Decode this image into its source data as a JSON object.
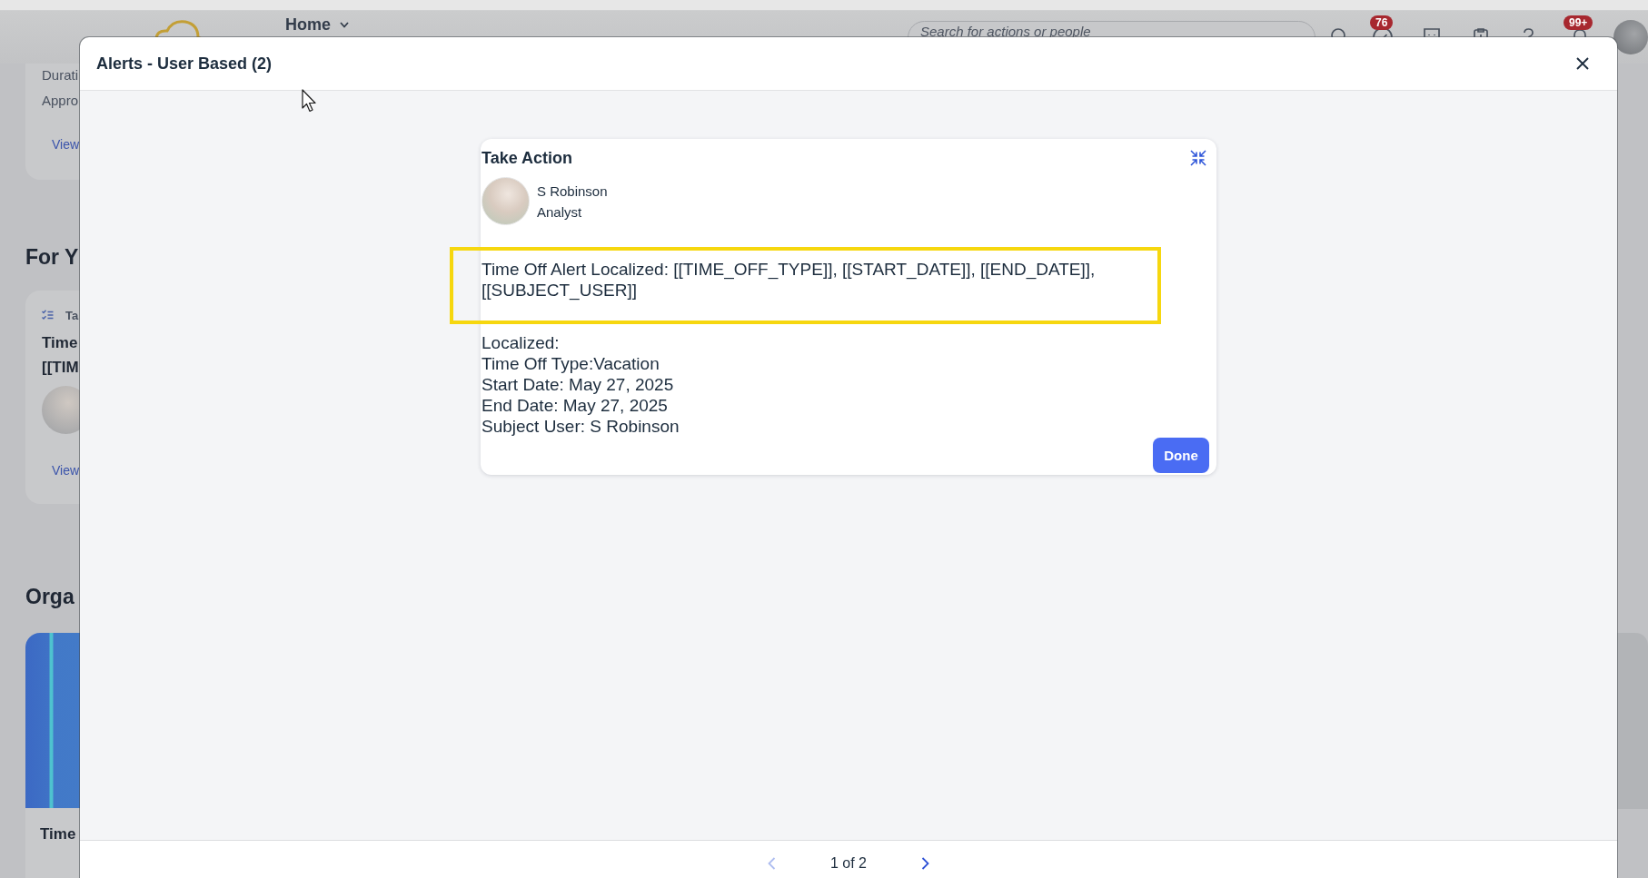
{
  "top_bar": {
    "menu": {
      "label": "Home"
    },
    "search": {
      "placeholder": "Search for actions or people"
    },
    "actions": [
      {
        "kind": "search"
      },
      {
        "kind": "check",
        "badge": "76"
      },
      {
        "kind": "chat"
      },
      {
        "kind": "clipboard"
      },
      {
        "kind": "help"
      },
      {
        "kind": "bell",
        "badge": "99+"
      }
    ]
  },
  "background": {
    "first_card": {
      "lines": [
        "Durati",
        "Appro"
      ],
      "link": "View"
    },
    "sections": [
      {
        "heading": "For Y",
        "card": {
          "kind": "task",
          "tag": "Ta",
          "title_lines": [
            "Time",
            "[[TIM"
          ],
          "link": "View"
        }
      },
      {
        "heading": "Orga",
        "card": {
          "kind": "image",
          "title": "Time"
        }
      }
    ]
  },
  "dialog": {
    "title": "Alerts - User Based (2)",
    "card": {
      "title": "Take Action",
      "person": {
        "name": "S Robinson",
        "role": "Analyst"
      },
      "message": {
        "text": "Time Off Alert Localized: [[TIME_OFF_TYPE]], [[START_DATE]], [[END_DATE]], [[SUBJECT_USER]]",
        "highlighted": true
      },
      "details": [
        "Localized:",
        "Time Off Type:Vacation",
        "Start Date: May 27, 2025",
        "End Date: May 27, 2025",
        "Subject User: S Robinson"
      ],
      "button": "Done"
    },
    "pager": {
      "text": "1 of 2",
      "previous": {
        "disabled": true
      },
      "next": {
        "disabled": false
      }
    }
  }
}
